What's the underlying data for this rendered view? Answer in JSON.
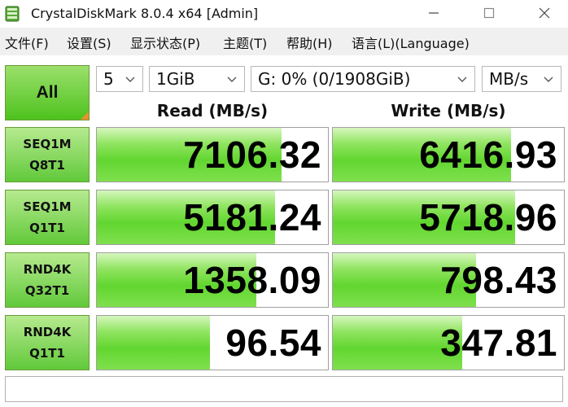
{
  "window": {
    "title": "CrystalDiskMark 8.0.4 x64 [Admin]"
  },
  "menu": [
    {
      "label": "文件(F)"
    },
    {
      "label": "设置(S)"
    },
    {
      "label": "显示状态(P)"
    },
    {
      "label": "主题(T)"
    },
    {
      "label": "帮助(H)"
    },
    {
      "label": "语言(L)(Language)"
    }
  ],
  "controls": {
    "all_label": "All",
    "count": "5",
    "size": "1GiB",
    "drive": "G: 0% (0/1908GiB)",
    "unit": "MB/s"
  },
  "headers": {
    "read": "Read (MB/s)",
    "write": "Write (MB/s)"
  },
  "tests": [
    {
      "line1": "SEQ1M",
      "line2": "Q8T1",
      "read": "7106.32",
      "write": "6416.93",
      "read_fill": 0.8,
      "write_fill": 0.77
    },
    {
      "line1": "SEQ1M",
      "line2": "Q1T1",
      "read": "5181.24",
      "write": "5718.96",
      "read_fill": 0.77,
      "write_fill": 0.79
    },
    {
      "line1": "RND4K",
      "line2": "Q32T1",
      "read": "1358.09",
      "write": "798.43",
      "read_fill": 0.69,
      "write_fill": 0.62
    },
    {
      "line1": "RND4K",
      "line2": "Q1T1",
      "read": "96.54",
      "write": "347.81",
      "read_fill": 0.49,
      "write_fill": 0.56
    }
  ],
  "status_text": ""
}
